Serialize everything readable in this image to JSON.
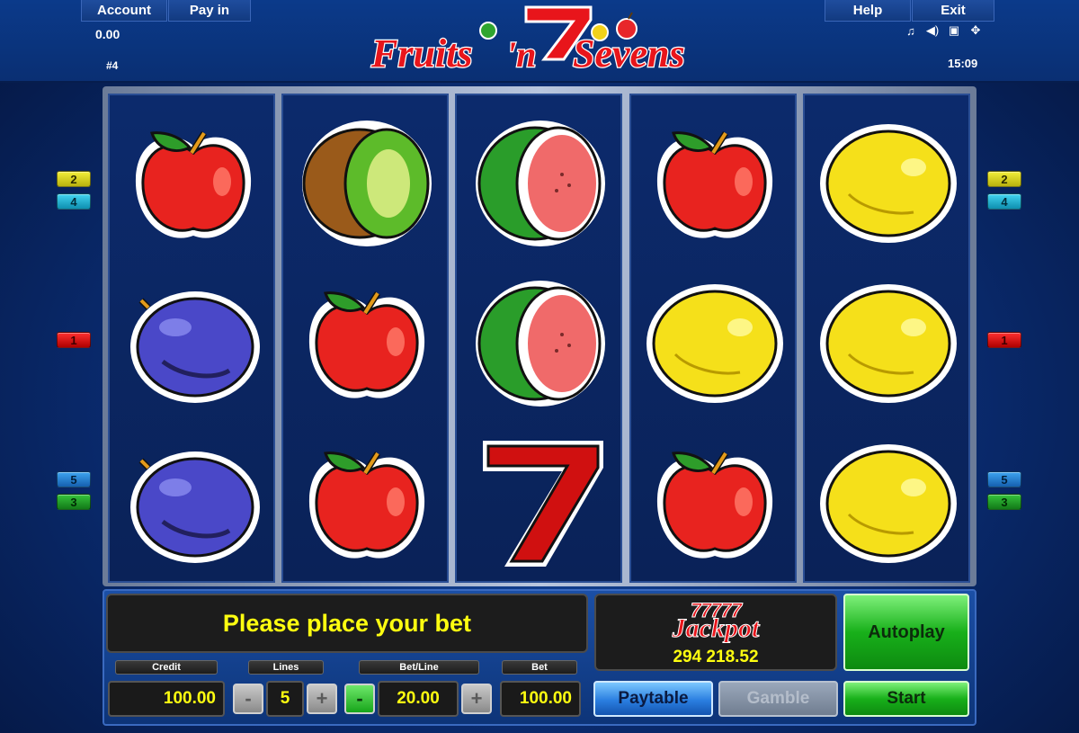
{
  "header": {
    "account_label": "Account",
    "payin_label": "Pay in",
    "help_label": "Help",
    "exit_label": "Exit",
    "account_value": "0.00",
    "game_id": "#4",
    "clock": "15:09",
    "logo_text_1": "Fruits",
    "logo_text_2": "'n",
    "logo_text_3": "Sevens",
    "icons": [
      "music-icon",
      "sound-icon",
      "fullscreen-icon",
      "settings-icon"
    ]
  },
  "reels": [
    [
      "apple",
      "plum",
      "plum"
    ],
    [
      "kiwi",
      "apple",
      "apple"
    ],
    [
      "watermelon",
      "watermelon",
      "seven"
    ],
    [
      "apple",
      "lemon",
      "apple"
    ],
    [
      "lemon",
      "lemon",
      "lemon"
    ]
  ],
  "line_markers": {
    "left": [
      "2",
      "4",
      "1",
      "5",
      "3"
    ],
    "right": [
      "2",
      "4",
      "1",
      "5",
      "3"
    ]
  },
  "message": "Please place your bet",
  "jackpot": {
    "sevens": "77777",
    "title": "Jackpot",
    "value": "294 218.52"
  },
  "controls": {
    "credit_label": "Credit",
    "credit_value": "100.00",
    "lines_label": "Lines",
    "lines_value": "5",
    "betline_label": "Bet/Line",
    "betline_value": "20.00",
    "bet_label": "Bet",
    "bet_value": "100.00",
    "minus": "-",
    "plus": "+",
    "paytable_label": "Paytable",
    "gamble_label": "Gamble",
    "start_label": "Start",
    "autoplay_label": "Autoplay"
  }
}
